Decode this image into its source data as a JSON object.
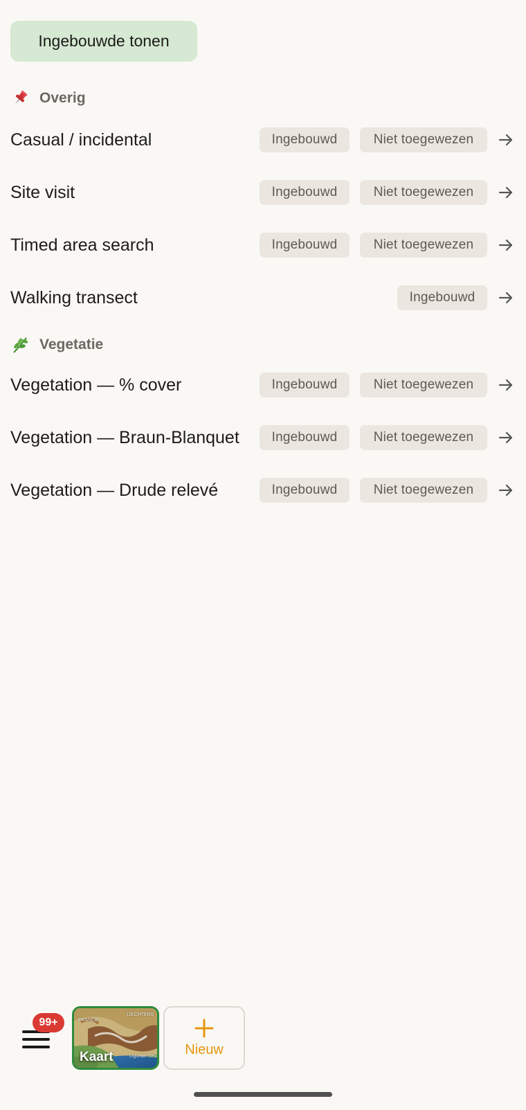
{
  "toggle_button": {
    "label": "Ingebouwde tonen"
  },
  "sections": [
    {
      "icon": "pushpin-icon",
      "header": "Overig",
      "rows": [
        {
          "title": "Casual / incidental",
          "chips": [
            "Ingebouwd",
            "Niet toegewezen"
          ]
        },
        {
          "title": "Site visit",
          "chips": [
            "Ingebouwd",
            "Niet toegewezen"
          ]
        },
        {
          "title": "Timed area search",
          "chips": [
            "Ingebouwd",
            "Niet toegewezen"
          ]
        },
        {
          "title": "Walking transect",
          "chips": [
            "Ingebouwd"
          ]
        }
      ]
    },
    {
      "icon": "herb-icon",
      "header": "Vegetatie",
      "rows": [
        {
          "title": "Vegetation — % cover",
          "chips": [
            "Ingebouwd",
            "Niet toegewezen"
          ]
        },
        {
          "title": "Vegetation — Braun-Blanquet",
          "chips": [
            "Ingebouwd",
            "Niet toegewezen"
          ]
        },
        {
          "title": "Vegetation — Drude relevé",
          "chips": [
            "Ingebouwd",
            "Niet toegewezen"
          ]
        }
      ]
    }
  ],
  "bottom_bar": {
    "badge": "99+",
    "map_label": "Kaart",
    "map_mini_labels": [
      "FRANCE",
      "LIECHTENS",
      "Ligurian Sea"
    ],
    "new_label": "Nieuw"
  },
  "colors": {
    "background": "#faf8f5",
    "toggle_bg": "#d6e9d3",
    "chip_bg": "#ebe6df",
    "badge": "#d93a32",
    "accent_orange": "#e6960f",
    "map_border": "#2e8b3e"
  }
}
